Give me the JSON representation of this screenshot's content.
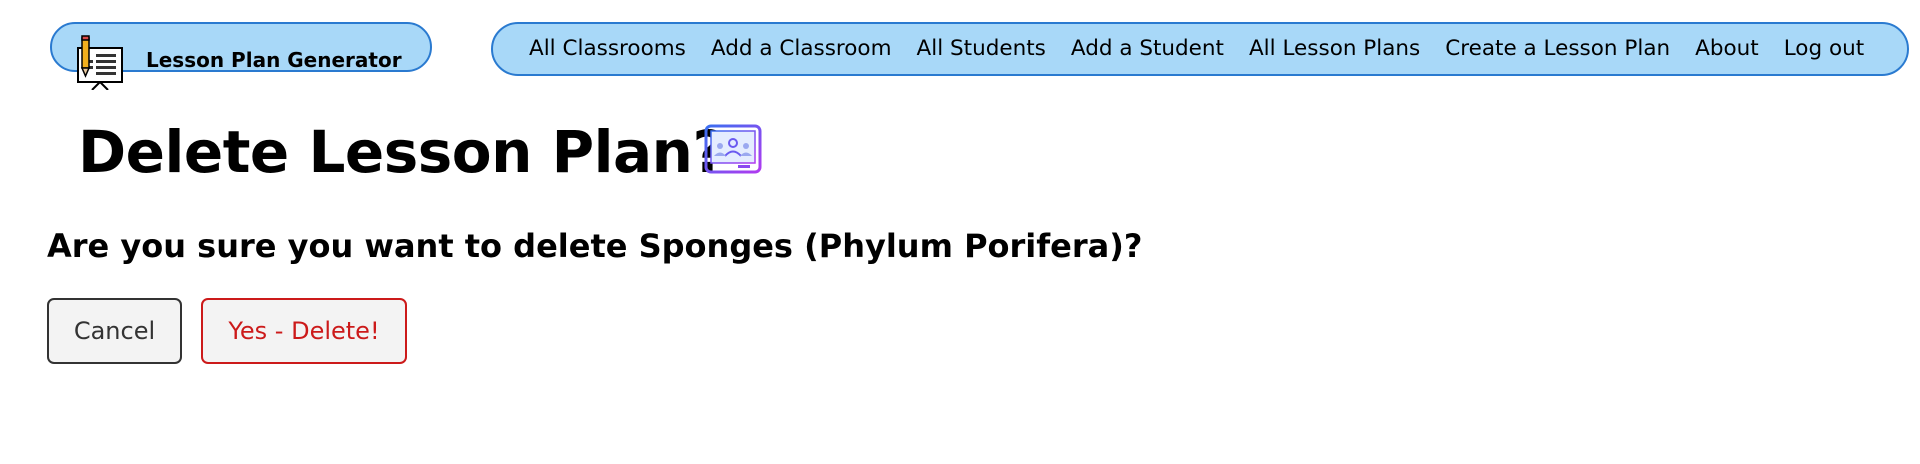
{
  "brand": {
    "label": "Lesson Plan Generator",
    "icon": "lesson-board-icon"
  },
  "nav": {
    "items": [
      {
        "label": "All Classrooms"
      },
      {
        "label": "Add a Classroom"
      },
      {
        "label": "All Students"
      },
      {
        "label": "Add a Student"
      },
      {
        "label": "All Lesson Plans"
      },
      {
        "label": "Create a Lesson Plan"
      },
      {
        "label": "About"
      },
      {
        "label": "Log out"
      }
    ]
  },
  "main": {
    "title": "Delete Lesson Plan?",
    "title_icon": "classroom-icon",
    "question": "Are you sure you want to delete Sponges (Phylum Porifera)?",
    "cancel_label": "Cancel",
    "confirm_label": "Yes - Delete!"
  },
  "colors": {
    "nav_background": "#a8d8f8",
    "nav_border": "#2a7ad0",
    "danger": "#cc1a1a",
    "button_background": "#f3f3f3"
  }
}
